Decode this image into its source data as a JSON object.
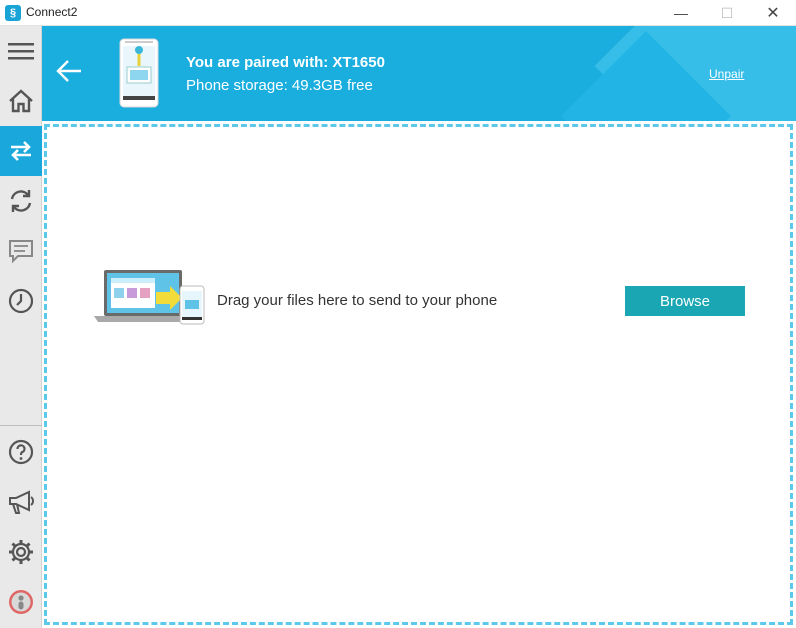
{
  "window": {
    "title": "Connect2",
    "app_icon": "connect2-logo-icon",
    "controls": {
      "minimize": "—",
      "maximize": "☐",
      "close": "✕"
    }
  },
  "sidebar": {
    "items": [
      {
        "icon": "hamburger-menu-icon"
      },
      {
        "icon": "home-icon"
      },
      {
        "icon": "transfer-arrows-icon",
        "active": true
      },
      {
        "icon": "sync-icon"
      },
      {
        "icon": "chat-message-icon"
      },
      {
        "icon": "clock-history-icon"
      },
      {
        "icon": "help-question-icon"
      },
      {
        "icon": "megaphone-icon"
      },
      {
        "icon": "gear-settings-icon"
      },
      {
        "icon": "user-avatar-icon"
      }
    ]
  },
  "header": {
    "title": "You are paired with: XT1650",
    "storage": "Phone storage: 49.3GB free",
    "unpair_label": "Unpair",
    "bg_color": "#1aaedf"
  },
  "dropzone": {
    "message": "Drag your files here to send to your phone",
    "browse_label": "Browse",
    "border_color": "#5cc8ea",
    "button_color": "#1aa7b3"
  }
}
